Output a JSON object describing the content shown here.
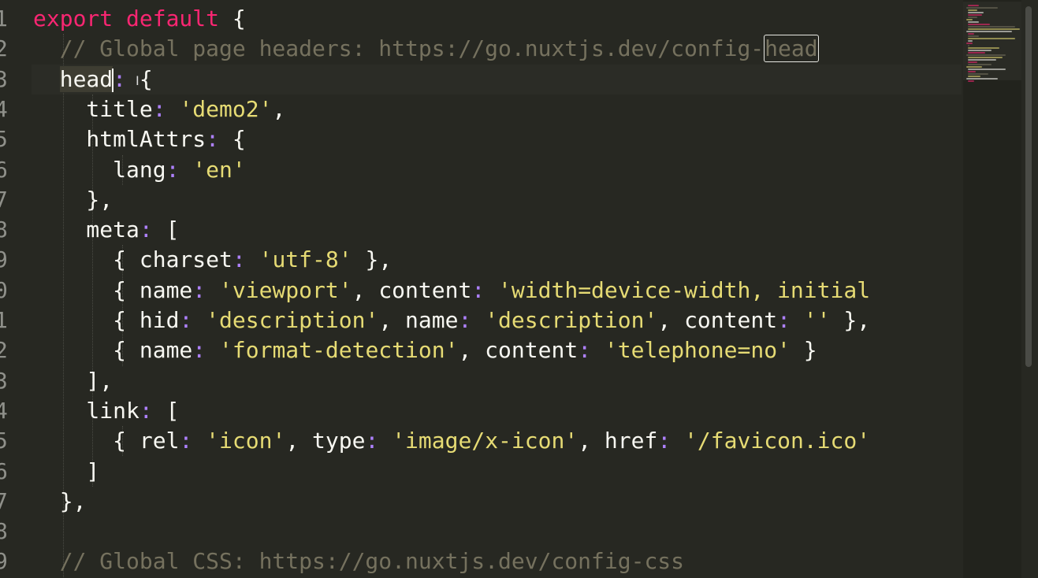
{
  "editor": {
    "line_numbers": [
      "1",
      "2",
      "3",
      "4",
      "5",
      "6",
      "7",
      "8",
      "9",
      "0",
      "1",
      "2",
      "3",
      "4",
      "5",
      "6",
      "7",
      "8",
      "9"
    ],
    "lines": [
      [
        {
          "c": "kw",
          "t": "export default"
        },
        {
          "c": "pn",
          "t": " {"
        }
      ],
      [
        {
          "c": "cm",
          "t": "  // Global page headers: https://go.nuxtjs.dev/config-"
        },
        {
          "c": "cm find",
          "t": "head"
        }
      ],
      [
        {
          "c": "pr sel",
          "t": "  head"
        },
        {
          "c": "cursor",
          "t": ""
        },
        {
          "c": "cl",
          "t": ":"
        },
        {
          "c": "pn",
          "t": " {"
        }
      ],
      [
        {
          "c": "pr",
          "t": "    title"
        },
        {
          "c": "cl",
          "t": ":"
        },
        {
          "c": "pn",
          "t": " "
        },
        {
          "c": "st",
          "t": "'demo2'"
        },
        {
          "c": "pn",
          "t": ","
        }
      ],
      [
        {
          "c": "pr",
          "t": "    htmlAttrs"
        },
        {
          "c": "cl",
          "t": ":"
        },
        {
          "c": "pn",
          "t": " {"
        }
      ],
      [
        {
          "c": "pr",
          "t": "      lang"
        },
        {
          "c": "cl",
          "t": ":"
        },
        {
          "c": "pn",
          "t": " "
        },
        {
          "c": "st",
          "t": "'en'"
        }
      ],
      [
        {
          "c": "pn",
          "t": "    },"
        }
      ],
      [
        {
          "c": "pr",
          "t": "    meta"
        },
        {
          "c": "cl",
          "t": ":"
        },
        {
          "c": "pn",
          "t": " ["
        }
      ],
      [
        {
          "c": "pn",
          "t": "      { "
        },
        {
          "c": "pr",
          "t": "charset"
        },
        {
          "c": "cl",
          "t": ":"
        },
        {
          "c": "pn",
          "t": " "
        },
        {
          "c": "st",
          "t": "'utf-8'"
        },
        {
          "c": "pn",
          "t": " },"
        }
      ],
      [
        {
          "c": "pn",
          "t": "      { "
        },
        {
          "c": "pr",
          "t": "name"
        },
        {
          "c": "cl",
          "t": ":"
        },
        {
          "c": "pn",
          "t": " "
        },
        {
          "c": "st",
          "t": "'viewport'"
        },
        {
          "c": "pn",
          "t": ", "
        },
        {
          "c": "pr",
          "t": "content"
        },
        {
          "c": "cl",
          "t": ":"
        },
        {
          "c": "pn",
          "t": " "
        },
        {
          "c": "st",
          "t": "'width=device-width, initial"
        }
      ],
      [
        {
          "c": "pn",
          "t": "      { "
        },
        {
          "c": "pr",
          "t": "hid"
        },
        {
          "c": "cl",
          "t": ":"
        },
        {
          "c": "pn",
          "t": " "
        },
        {
          "c": "st",
          "t": "'description'"
        },
        {
          "c": "pn",
          "t": ", "
        },
        {
          "c": "pr",
          "t": "name"
        },
        {
          "c": "cl",
          "t": ":"
        },
        {
          "c": "pn",
          "t": " "
        },
        {
          "c": "st",
          "t": "'description'"
        },
        {
          "c": "pn",
          "t": ", "
        },
        {
          "c": "pr",
          "t": "content"
        },
        {
          "c": "cl",
          "t": ":"
        },
        {
          "c": "pn",
          "t": " "
        },
        {
          "c": "st",
          "t": "''"
        },
        {
          "c": "pn",
          "t": " },"
        }
      ],
      [
        {
          "c": "pn",
          "t": "      { "
        },
        {
          "c": "pr",
          "t": "name"
        },
        {
          "c": "cl",
          "t": ":"
        },
        {
          "c": "pn",
          "t": " "
        },
        {
          "c": "st",
          "t": "'format-detection'"
        },
        {
          "c": "pn",
          "t": ", "
        },
        {
          "c": "pr",
          "t": "content"
        },
        {
          "c": "cl",
          "t": ":"
        },
        {
          "c": "pn",
          "t": " "
        },
        {
          "c": "st",
          "t": "'telephone=no'"
        },
        {
          "c": "pn",
          "t": " }"
        }
      ],
      [
        {
          "c": "pn",
          "t": "    ],"
        }
      ],
      [
        {
          "c": "pr",
          "t": "    link"
        },
        {
          "c": "cl",
          "t": ":"
        },
        {
          "c": "pn",
          "t": " ["
        }
      ],
      [
        {
          "c": "pn",
          "t": "      { "
        },
        {
          "c": "pr",
          "t": "rel"
        },
        {
          "c": "cl",
          "t": ":"
        },
        {
          "c": "pn",
          "t": " "
        },
        {
          "c": "st",
          "t": "'icon'"
        },
        {
          "c": "pn",
          "t": ", "
        },
        {
          "c": "pr",
          "t": "type"
        },
        {
          "c": "cl",
          "t": ":"
        },
        {
          "c": "pn",
          "t": " "
        },
        {
          "c": "st",
          "t": "'image/x-icon'"
        },
        {
          "c": "pn",
          "t": ", "
        },
        {
          "c": "pr",
          "t": "href"
        },
        {
          "c": "cl",
          "t": ":"
        },
        {
          "c": "pn",
          "t": " "
        },
        {
          "c": "st",
          "t": "'/favicon.ico'"
        }
      ],
      [
        {
          "c": "pn",
          "t": "    ]"
        }
      ],
      [
        {
          "c": "pn",
          "t": "  },"
        }
      ],
      [
        {
          "c": "pn",
          "t": ""
        }
      ],
      [
        {
          "c": "cm",
          "t": "  // Global CSS: https://go.nuxtjs.dev/config-css"
        }
      ]
    ]
  },
  "colors": {
    "background": "#272822",
    "keyword": "#f92672",
    "comment": "#75715e",
    "string": "#e6db74",
    "colon": "#ae81ff",
    "text": "#f8f8f2",
    "line_number": "#8f908a"
  },
  "cursor": {
    "icon": "text-cursor-icon",
    "glyph": "I"
  }
}
